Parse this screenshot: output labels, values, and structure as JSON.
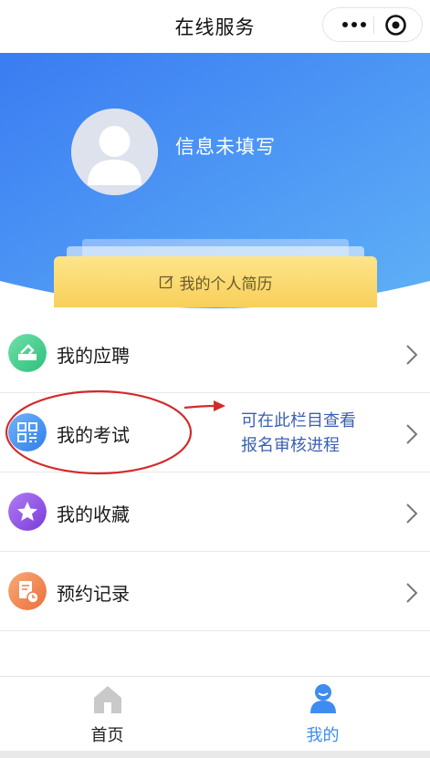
{
  "title_bar": {
    "title": "在线服务",
    "more_icon": "more-dots-icon",
    "close_icon": "target-circle-icon"
  },
  "profile": {
    "name_text": "信息未填写",
    "avatar_icon": "default-avatar-icon",
    "resume_button_label": "我的个人简历",
    "resume_icon": "edit-icon"
  },
  "menu": {
    "items": [
      {
        "label": "我的应聘",
        "icon": "application-tray-icon",
        "color": "#3ecf8e"
      },
      {
        "label": "我的考试",
        "icon": "grid-qr-icon",
        "color": "#3d8ef0"
      },
      {
        "label": "我的收藏",
        "icon": "star-icon",
        "color": "#8b4fe0"
      },
      {
        "label": "预约记录",
        "icon": "record-clock-icon",
        "color": "#f28a4e"
      }
    ]
  },
  "annotation": {
    "line1": "可在此栏目查看",
    "line2": "报名审核进程",
    "color": "#d42a2a"
  },
  "tabbar": {
    "tabs": [
      {
        "label": "首页",
        "icon": "home-icon",
        "active": false
      },
      {
        "label": "我的",
        "icon": "user-icon",
        "active": true
      }
    ],
    "active_color": "#3f8cf0"
  },
  "colors": {
    "header_gradient_start": "#3a7cf2",
    "header_gradient_end": "#5fb0f7",
    "resume_button": "#f8cf5a"
  }
}
